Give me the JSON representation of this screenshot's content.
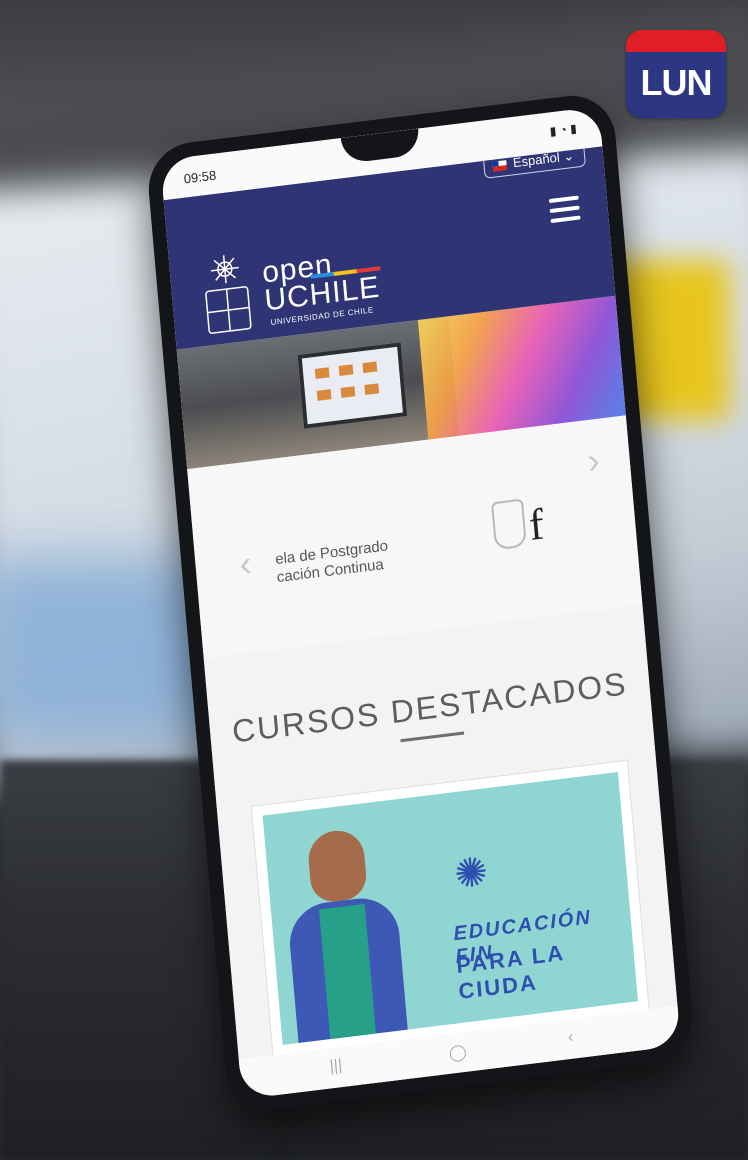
{
  "badge": {
    "text": "LUN",
    "colors": {
      "top": "#e01e26",
      "bottom": "#2c3683"
    }
  },
  "phone": {
    "status": {
      "time": "09:58"
    },
    "header": {
      "language": "Español",
      "logo_open": "open",
      "logo_uchile": "UCHILE",
      "logo_subtitle": "UNIVERSIDAD DE CHILE",
      "color": "#2f3574"
    },
    "carousel": {
      "partner_line1": "ela de Postgrado",
      "partner_line2": "cación Continua",
      "partner_letter": "f",
      "prev_icon": "chevron-left-icon",
      "next_icon": "chevron-right-icon"
    },
    "section": {
      "title": "CURSOS DESTACADOS",
      "card_text1": "EDUCACIÓN FIN",
      "card_text2": "PARA LA CIUDA"
    }
  }
}
